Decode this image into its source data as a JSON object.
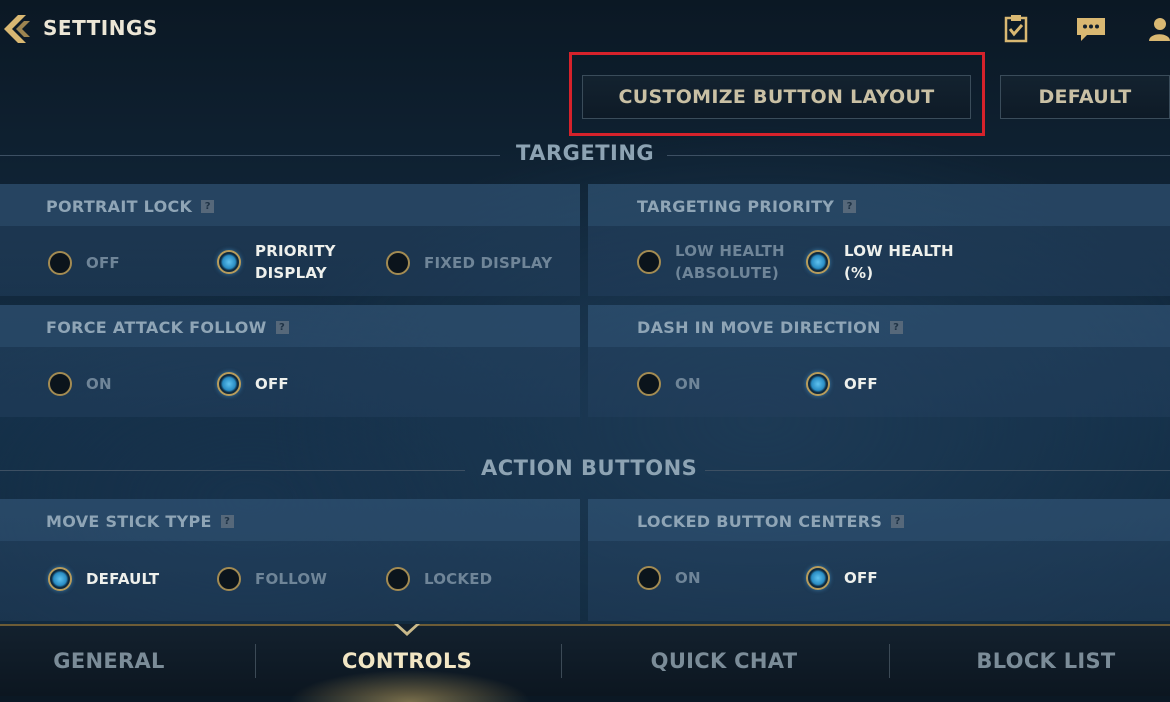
{
  "header": {
    "title": "SETTINGS",
    "icons": [
      "back-chevron-icon",
      "checklist-icon",
      "chat-icon",
      "friends-icon"
    ]
  },
  "actions": {
    "customize_label": "CUSTOMIZE BUTTON LAYOUT",
    "default_label": "DEFAULT"
  },
  "sections": {
    "targeting": "TARGETING",
    "action_buttons": "ACTION BUTTONS"
  },
  "settings": {
    "portrait_lock": {
      "label": "PORTRAIT LOCK",
      "options": [
        "OFF",
        "PRIORITY\nDISPLAY",
        "FIXED DISPLAY"
      ],
      "selected": "PRIORITY DISPLAY"
    },
    "targeting_priority": {
      "label": "TARGETING PRIORITY",
      "options": [
        "LOW HEALTH\n(ABSOLUTE)",
        "LOW HEALTH\n(%)"
      ],
      "selected": "LOW HEALTH (%)"
    },
    "force_attack_follow": {
      "label": "FORCE ATTACK FOLLOW",
      "options": [
        "ON",
        "OFF"
      ],
      "selected": "OFF"
    },
    "dash_in_move_direction": {
      "label": "DASH IN MOVE DIRECTION",
      "options": [
        "ON",
        "OFF"
      ],
      "selected": "OFF"
    },
    "move_stick_type": {
      "label": "MOVE STICK TYPE",
      "options": [
        "DEFAULT",
        "FOLLOW",
        "LOCKED"
      ],
      "selected": "DEFAULT"
    },
    "locked_button_centers": {
      "label": "LOCKED BUTTON CENTERS",
      "options": [
        "ON",
        "OFF"
      ],
      "selected": "OFF"
    }
  },
  "help_glyph": "?",
  "tabs": [
    {
      "label": "GENERAL",
      "active": false
    },
    {
      "label": "CONTROLS",
      "active": true
    },
    {
      "label": "QUICK CHAT",
      "active": false
    },
    {
      "label": "BLOCK LIST",
      "active": false
    }
  ],
  "colors": {
    "accent_gold": "#c9b98a",
    "selected_radio": "#2a8dc4",
    "highlight_box": "#d6222b"
  }
}
